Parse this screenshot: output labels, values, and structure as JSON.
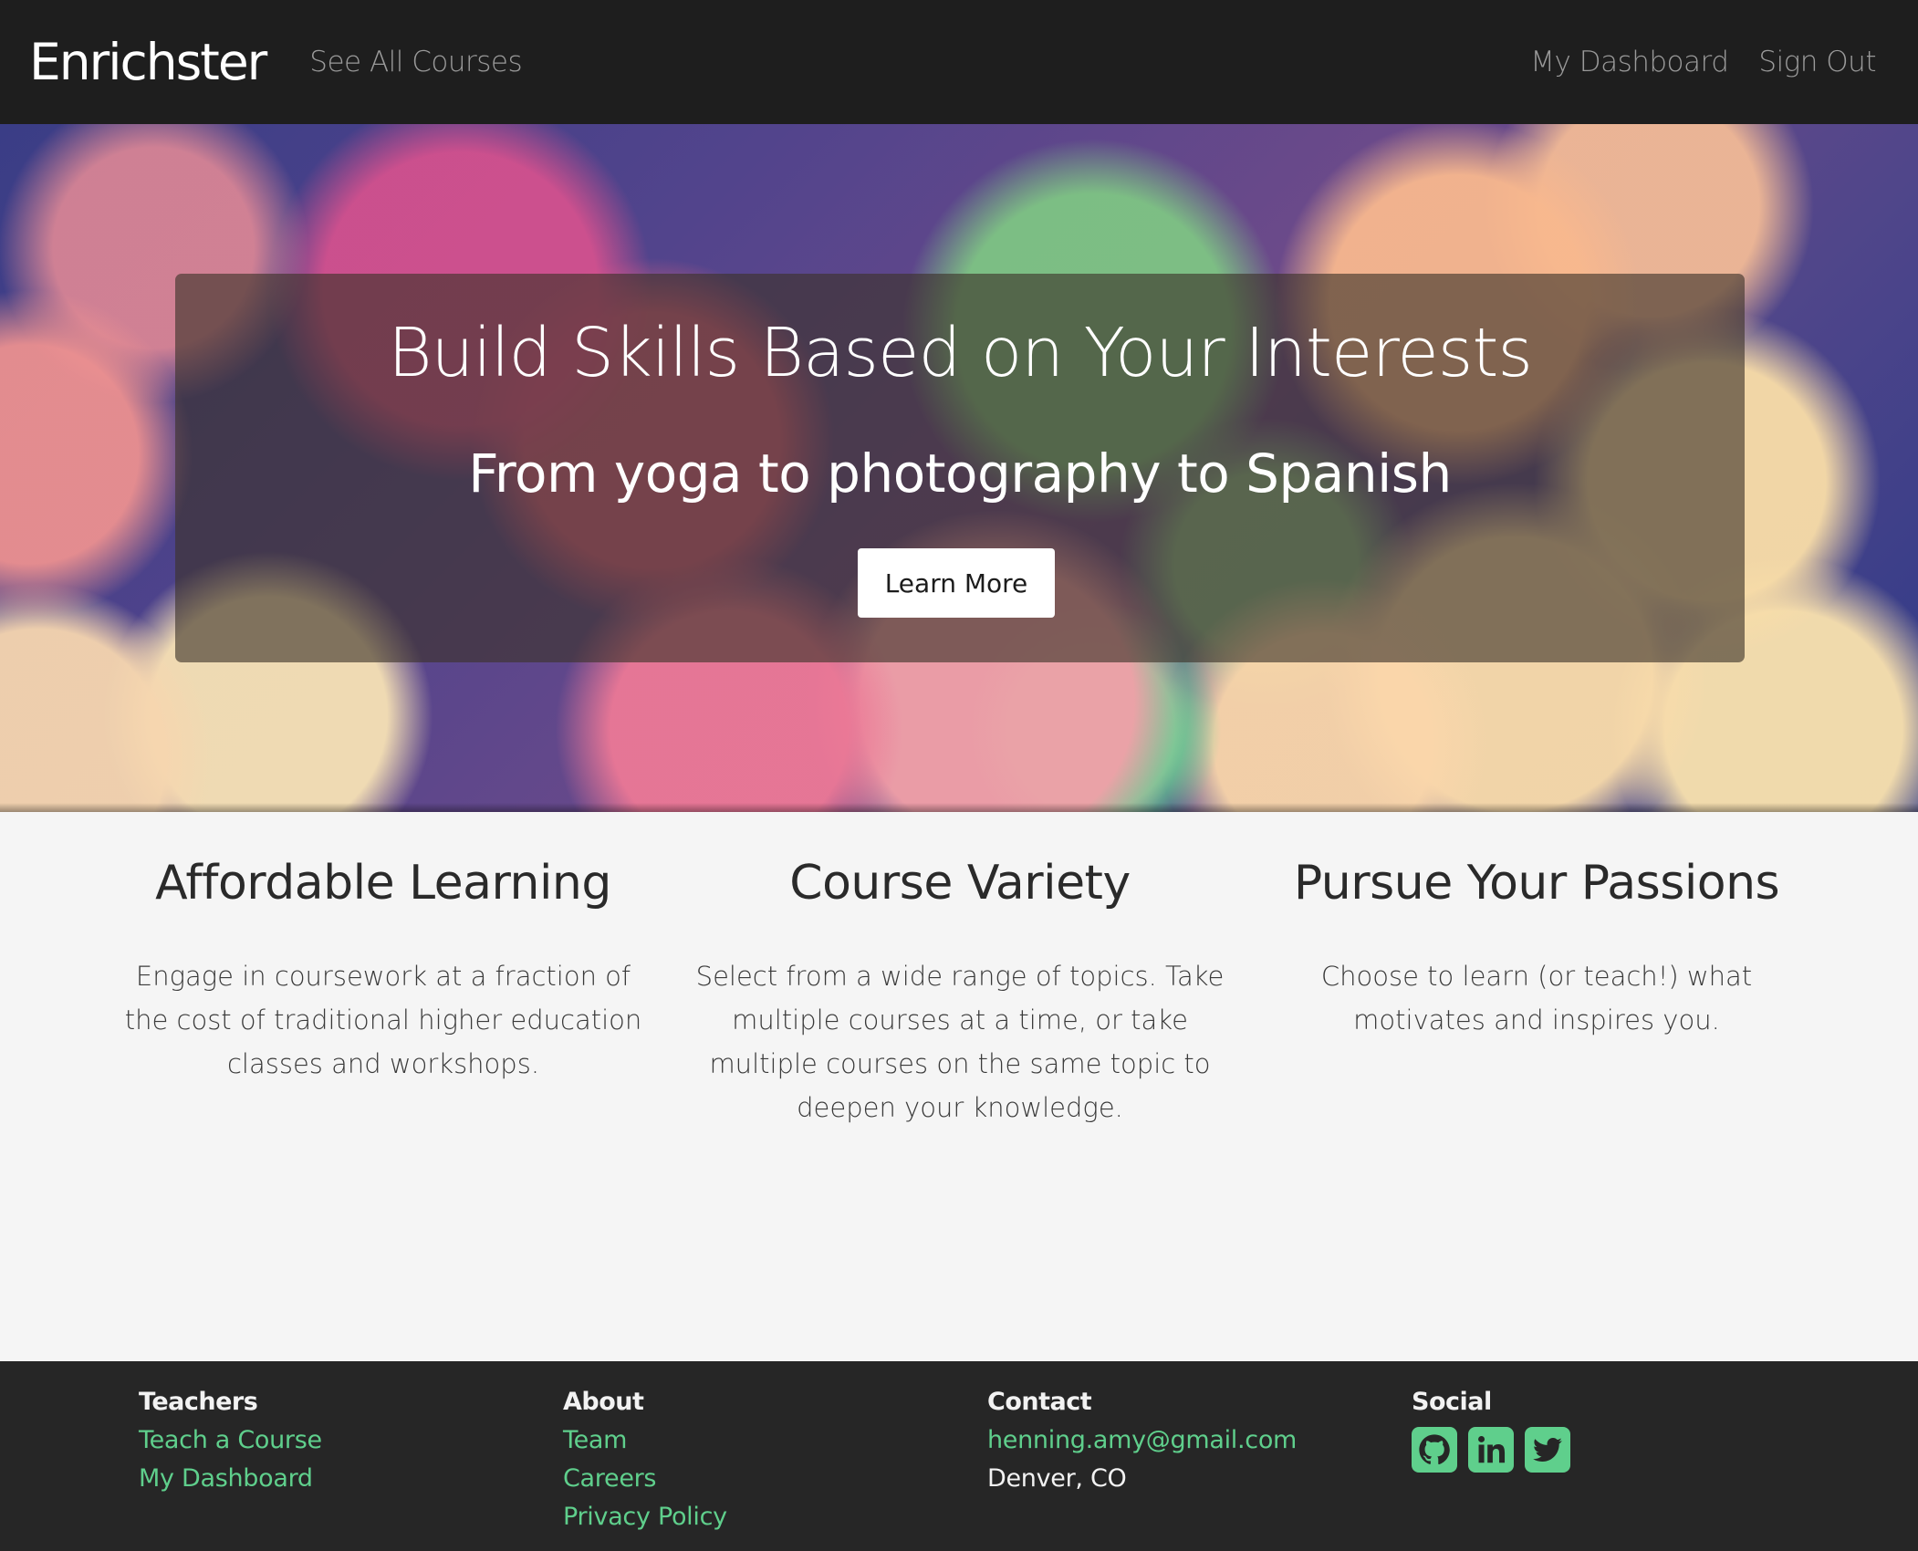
{
  "navbar": {
    "brand": "Enrichster",
    "see_all_courses": "See All Courses",
    "my_dashboard": "My Dashboard",
    "sign_out": "Sign Out"
  },
  "hero": {
    "title": "Build Skills Based on Your Interests",
    "subtitle": "From yoga to photography to Spanish",
    "button_label": "Learn More"
  },
  "features": [
    {
      "title": "Affordable Learning",
      "description": "Engage in coursework at a fraction of the cost of traditional higher education classes and workshops."
    },
    {
      "title": "Course Variety",
      "description": "Select from a wide range of topics. Take multiple courses at a time, or take multiple courses on the same topic to deepen your knowledge."
    },
    {
      "title": "Pursue Your Passions",
      "description": "Choose to learn (or teach!) what motivates and inspires you."
    }
  ],
  "footer": {
    "teachers": {
      "heading": "Teachers",
      "links": [
        "Teach a Course",
        "My Dashboard"
      ]
    },
    "about": {
      "heading": "About",
      "links": [
        "Team",
        "Careers",
        "Privacy Policy"
      ]
    },
    "contact": {
      "heading": "Contact",
      "email": "henning.amy@gmail.com",
      "location": "Denver, CO"
    },
    "social": {
      "heading": "Social",
      "icons": [
        "github-icon",
        "linkedin-icon",
        "twitter-icon"
      ]
    }
  },
  "colors": {
    "accent_green": "#5fcf8c",
    "navbar_bg": "#1e1e1e",
    "footer_bg": "#262626",
    "page_bg": "#f5f5f5"
  }
}
